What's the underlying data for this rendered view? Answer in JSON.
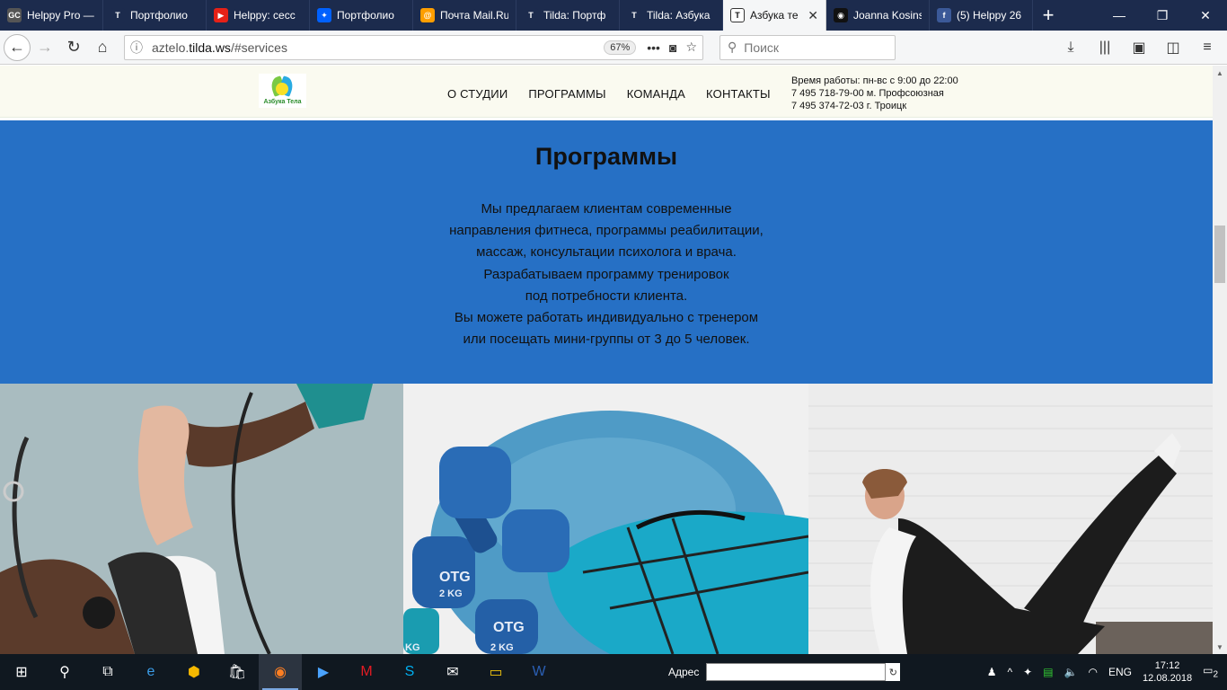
{
  "browser": {
    "tabs": [
      {
        "label": "Helppy Pro —",
        "fav_bg": "#555555",
        "fav_text": "GC"
      },
      {
        "label": "Портфолио",
        "fav_bg": "#1c2b4d",
        "fav_text": "T"
      },
      {
        "label": "Helppy: сесс",
        "fav_bg": "#e62117",
        "fav_text": "▶"
      },
      {
        "label": "Портфолио",
        "fav_bg": "#0061fe",
        "fav_text": "✦"
      },
      {
        "label": "Почта Mail.Ru",
        "fav_bg": "#ff9e00",
        "fav_text": "@"
      },
      {
        "label": "Tilda: Портф",
        "fav_bg": "#1c2b4d",
        "fav_text": "T"
      },
      {
        "label": "Tilda: Азбука",
        "fav_bg": "#1c2b4d",
        "fav_text": "T"
      },
      {
        "label": "Азбука те",
        "fav_bg": "#ffffff",
        "fav_text": "T",
        "active": true
      },
      {
        "label": "Joanna Kosins",
        "fav_bg": "#111111",
        "fav_text": "◉"
      },
      {
        "label": "(5) Helppy 26",
        "fav_bg": "#3b5998",
        "fav_text": "f"
      }
    ],
    "url_host": "aztelo.",
    "url_domain": "tilda.ws",
    "url_path": "/#services",
    "zoom": "67%",
    "search_placeholder": "Поиск"
  },
  "site": {
    "logo_text": "Азбука Тела",
    "menu": [
      "О СТУДИИ",
      "ПРОГРАММЫ",
      "КОМАНДА",
      "КОНТАКТЫ"
    ],
    "contacts": [
      "Время работы: пн-вс с 9:00 до 22:00",
      "7 495 718-79-00 м. Профсоюзная",
      "7 495 374-72-03 г. Троицк"
    ],
    "accent_color": "#2670c5"
  },
  "programs": {
    "title": "Программы",
    "lines": [
      "Мы предлагаем клиентам современные",
      "направления фитнеса, программы реабилитации,",
      "массаж, консультации психолога и врача.",
      "Разрабатываем программу тренировок",
      "под потребности клиента.",
      "Вы можете работать индивидуально с тренером",
      "или посещать мини-группы от 3 до 5 человек."
    ]
  },
  "photos": {
    "dumbbell_label_1": "OTG",
    "dumbbell_weight_1": "2 KG",
    "dumbbell_label_2": "OTG",
    "dumbbell_weight_2": "2 KG",
    "dumbbell_weight_3": "KG"
  },
  "taskbar": {
    "address_label": "Адрес",
    "language": "ENG",
    "time": "17:12",
    "date": "12.08.2018",
    "notifications": "2"
  }
}
